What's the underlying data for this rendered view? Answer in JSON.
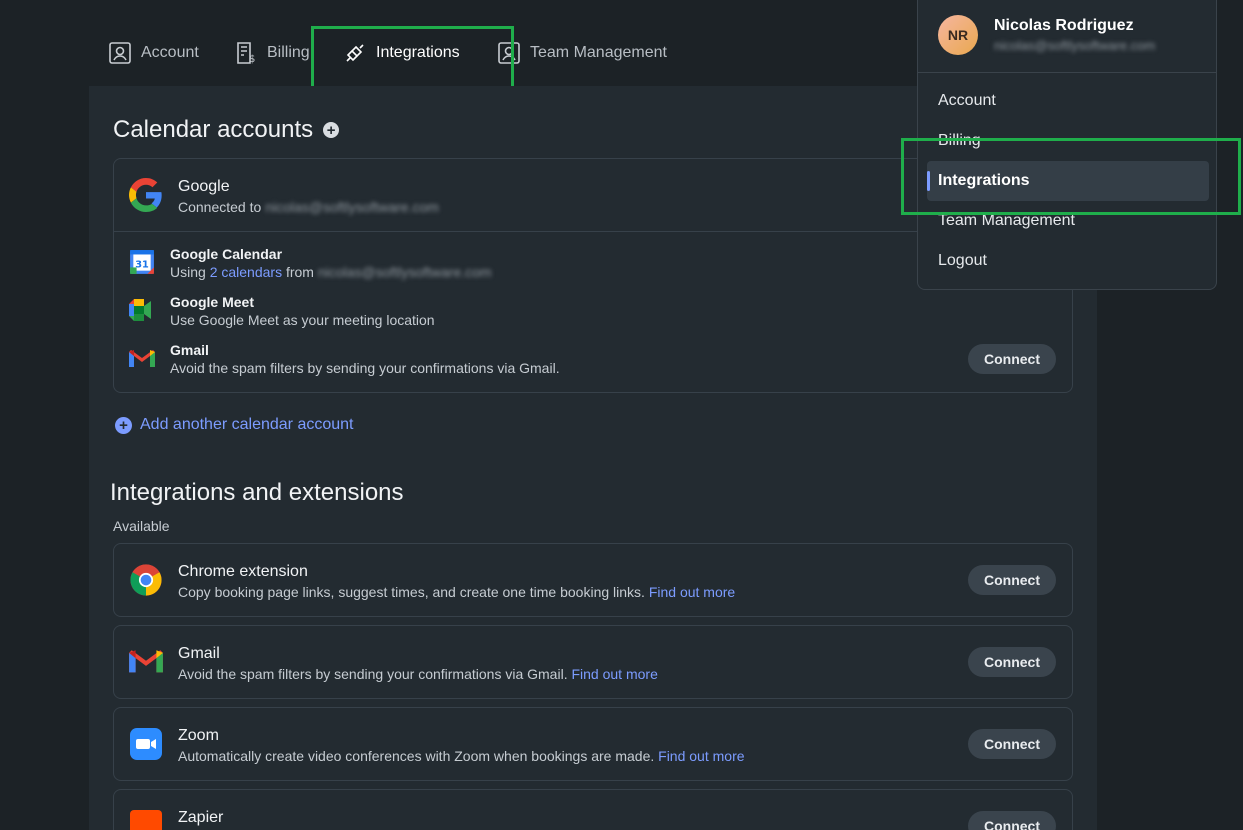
{
  "tabs": [
    {
      "label": "Account",
      "icon": "account-icon"
    },
    {
      "label": "Billing",
      "icon": "billing-icon"
    },
    {
      "label": "Integrations",
      "icon": "integrations-icon",
      "active": true
    },
    {
      "label": "Team Management",
      "icon": "team-icon"
    }
  ],
  "calendar": {
    "title": "Calendar accounts",
    "google": {
      "name": "Google",
      "connected_prefix": "Connected to",
      "email": "nicolas@softlysoftware.com"
    },
    "services": [
      {
        "name": "Google Calendar",
        "desc_prefix": "Using",
        "desc_link": "2 calendars",
        "desc_mid": "from",
        "email": "nicolas@softlysoftware.com"
      },
      {
        "name": "Google Meet",
        "desc": "Use Google Meet as your meeting location"
      },
      {
        "name": "Gmail",
        "desc": "Avoid the spam filters by sending your confirmations via Gmail.",
        "button": "Connect"
      }
    ],
    "add_label": "Add another calendar account"
  },
  "integrations": {
    "title": "Integrations and extensions",
    "subhead": "Available",
    "find_more": "Find out more",
    "items": [
      {
        "name": "Chrome extension",
        "desc": "Copy booking page links, suggest times, and create one time booking links.",
        "button": "Connect"
      },
      {
        "name": "Gmail",
        "desc": "Avoid the spam filters by sending your confirmations via Gmail.",
        "button": "Connect"
      },
      {
        "name": "Zoom",
        "desc": "Automatically create video conferences with Zoom when bookings are made.",
        "button": "Connect"
      },
      {
        "name": "Zapier",
        "button": "Connect"
      }
    ]
  },
  "user_menu": {
    "initials": "NR",
    "name": "Nicolas Rodriguez",
    "email": "nicolas@softlysoftware.com",
    "items": [
      "Account",
      "Billing",
      "Integrations",
      "Team Management",
      "Logout"
    ],
    "active_item": "Integrations"
  },
  "colors": {
    "accent": "#7c9cff",
    "highlight": "#1fae4b",
    "panel": "#232b31",
    "background": "#1c2226"
  }
}
